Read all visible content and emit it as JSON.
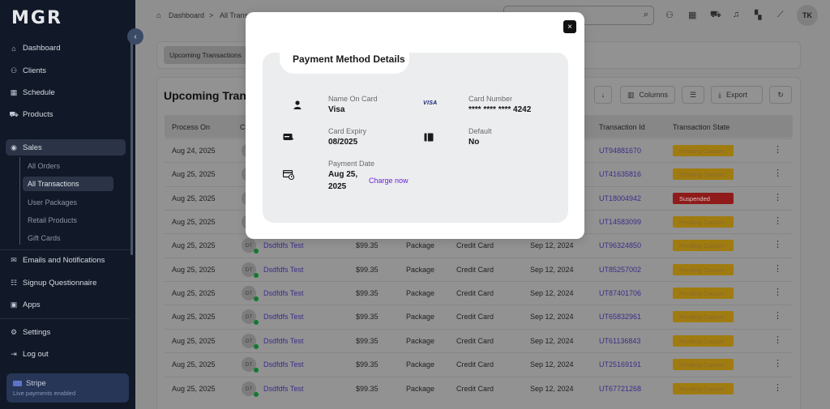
{
  "app": {
    "logo": "MGR"
  },
  "sidebar": {
    "collapse_icon": "‹",
    "items": [
      {
        "label": "Dashboard",
        "icon": "home-icon",
        "glyph": "⌂"
      },
      {
        "label": "Clients",
        "icon": "user-icon",
        "glyph": "⚇"
      },
      {
        "label": "Schedule",
        "icon": "calendar-icon",
        "glyph": "▦"
      },
      {
        "label": "Products",
        "icon": "cart-icon",
        "glyph": "⛟"
      },
      {
        "label": "Sales",
        "icon": "sales-icon",
        "glyph": "◉"
      },
      {
        "label": "Emails and Notifications",
        "icon": "mail-icon",
        "glyph": "✉"
      },
      {
        "label": "Signup Questionnaire",
        "icon": "form-icon",
        "glyph": "☷"
      },
      {
        "label": "Apps",
        "icon": "apps-icon",
        "glyph": "▣"
      },
      {
        "label": "Settings",
        "icon": "gear-icon",
        "glyph": "⚙"
      },
      {
        "label": "Log out",
        "icon": "logout-icon",
        "glyph": "⇥"
      }
    ],
    "sales_sub": [
      "All Orders",
      "All Transactions",
      "User Packages",
      "Retail Products",
      "Gift Cards"
    ],
    "stripe": {
      "name": "Stripe",
      "status": "Live payments enabled"
    }
  },
  "topbar": {
    "breadcrumb_home": "Dashboard",
    "breadcrumb_sep": ">",
    "breadcrumb_current": "All Trans",
    "user_initials": "TK"
  },
  "tabs": {
    "active": "Upcoming Transactions"
  },
  "table": {
    "title": "Upcoming Transa",
    "buttons": {
      "columns": "Columns",
      "export": "Export"
    },
    "headers": {
      "process_on": "Process On",
      "c": "C",
      "transaction_id": "Transaction Id",
      "transaction_state": "Transaction State"
    },
    "rows": [
      {
        "process_on": "Aug 24, 2025",
        "initials": "",
        "client": "",
        "amount": "",
        "type": "",
        "method": "",
        "created": "",
        "id": "UT94881670",
        "state": "Pending Capture"
      },
      {
        "process_on": "Aug 25, 2025",
        "initials": "",
        "client": "",
        "amount": "",
        "type": "",
        "method": "",
        "created": "",
        "id": "UT41635816",
        "state": "Pending Capture"
      },
      {
        "process_on": "Aug 25, 2025",
        "initials": "",
        "client": "",
        "amount": "",
        "type": "",
        "method": "",
        "created": "",
        "id": "UT18004942",
        "state": "Suspended"
      },
      {
        "process_on": "Aug 25, 2025",
        "initials": "",
        "client": "",
        "amount": "",
        "type": "",
        "method": "",
        "created": "",
        "id": "UT14583099",
        "state": "Pending Capture"
      },
      {
        "process_on": "Aug 25, 2025",
        "initials": "DT",
        "client": "Dsdfdfs Test",
        "amount": "$99.35",
        "type": "Package",
        "method": "Credit Card",
        "created": "Sep 12, 2024",
        "id": "UT96324850",
        "state": "Pending Capture"
      },
      {
        "process_on": "Aug 25, 2025",
        "initials": "DT",
        "client": "Dsdfdfs Test",
        "amount": "$99.35",
        "type": "Package",
        "method": "Credit Card",
        "created": "Sep 12, 2024",
        "id": "UT85257002",
        "state": "Pending Capture"
      },
      {
        "process_on": "Aug 25, 2025",
        "initials": "DT",
        "client": "Dsdfdfs Test",
        "amount": "$99.35",
        "type": "Package",
        "method": "Credit Card",
        "created": "Sep 12, 2024",
        "id": "UT87401706",
        "state": "Pending Capture"
      },
      {
        "process_on": "Aug 25, 2025",
        "initials": "DT",
        "client": "Dsdfdfs Test",
        "amount": "$99.35",
        "type": "Package",
        "method": "Credit Card",
        "created": "Sep 12, 2024",
        "id": "UT65832961",
        "state": "Pending Capture"
      },
      {
        "process_on": "Aug 25, 2025",
        "initials": "DT",
        "client": "Dsdfdfs Test",
        "amount": "$99.35",
        "type": "Package",
        "method": "Credit Card",
        "created": "Sep 12, 2024",
        "id": "UT61136843",
        "state": "Pending Capture"
      },
      {
        "process_on": "Aug 25, 2025",
        "initials": "DT",
        "client": "Dsdfdfs Test",
        "amount": "$99.35",
        "type": "Package",
        "method": "Credit Card",
        "created": "Sep 12, 2024",
        "id": "UT25169191",
        "state": "Pending Capture"
      },
      {
        "process_on": "Aug 25, 2025",
        "initials": "DT",
        "client": "Dsdfdfs Test",
        "amount": "$99.35",
        "type": "Package",
        "method": "Credit Card",
        "created": "Sep 12, 2024",
        "id": "UT67721268",
        "state": "Pending Capture"
      }
    ]
  },
  "modal": {
    "title": "Payment Method Details",
    "close_icon": "×",
    "name_on_card": {
      "label": "Name On Card",
      "value": "Visa"
    },
    "card_number": {
      "label": "Card Number",
      "value": "**** **** **** 4242",
      "brand": "VISA"
    },
    "card_expiry": {
      "label": "Card Expiry",
      "value": "08/2025"
    },
    "default": {
      "label": "Default",
      "value": "No"
    },
    "payment_date": {
      "label": "Payment Date",
      "value_line1": "Aug 25,",
      "value_line2": "2025",
      "action": "Charge now"
    }
  },
  "colors": {
    "sidebar_bg": "#111827",
    "accent_purple": "#6a22d6",
    "pending_badge": "#f5b400",
    "suspended_badge": "#e11d1d",
    "overlay": "rgba(0,0,0,0.45)"
  }
}
